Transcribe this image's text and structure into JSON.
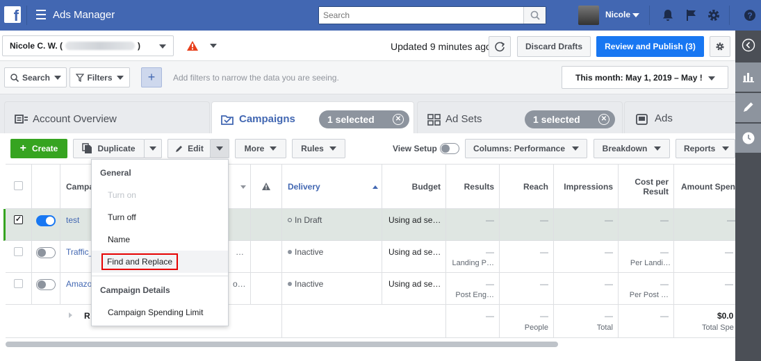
{
  "topbar": {
    "app_title": "Ads Manager",
    "search_placeholder": "Search",
    "user_name": "Nicole"
  },
  "account_bar": {
    "account_name": "Nicole C. W. (",
    "account_name_suffix": ")",
    "updated_text": "Updated 9 minutes ago",
    "discard_label": "Discard Drafts",
    "publish_label": "Review and Publish (3)"
  },
  "filter_bar": {
    "search_label": "Search",
    "filters_label": "Filters",
    "filter_hint": "Add filters to narrow the data you are seeing.",
    "date_range": "This month: May 1, 2019 – May !"
  },
  "tabs": [
    {
      "label": "Account Overview"
    },
    {
      "label": "Campaigns",
      "selected_text": "1 selected"
    },
    {
      "label": "Ad Sets",
      "selected_text": "1 selected"
    },
    {
      "label": "Ads"
    }
  ],
  "toolbar": {
    "create_label": "Create",
    "duplicate_label": "Duplicate",
    "edit_label": "Edit",
    "more_label": "More",
    "rules_label": "Rules",
    "view_setup_label": "View Setup",
    "columns_label": "Columns: Performance",
    "breakdown_label": "Breakdown",
    "reports_label": "Reports"
  },
  "table": {
    "headers": {
      "campaign": "Campa",
      "delivery": "Delivery",
      "budget": "Budget",
      "results": "Results",
      "reach": "Reach",
      "impressions": "Impressions",
      "cost_line1": "Cost per",
      "cost_line2": "Result",
      "amount": "Amount Spen"
    },
    "rows": [
      {
        "name": "test",
        "delivery": "In Draft",
        "budget": "Using ad se…",
        "results": "—",
        "results_sub": "",
        "reach": "—",
        "impressions": "—",
        "cost": "—",
        "cost_sub": "",
        "amount": "—",
        "toggle_on": true,
        "checked": true
      },
      {
        "name": "Traffic_",
        "trunc": "…",
        "delivery": "Inactive",
        "budget": "Using ad se…",
        "results": "—",
        "results_sub": "Landing P…",
        "reach": "—",
        "impressions": "—",
        "cost": "—",
        "cost_sub": "Per Landi…",
        "amount": "—",
        "toggle_on": false,
        "checked": false
      },
      {
        "name": "Amazo",
        "trunc": "o…",
        "delivery": "Inactive",
        "budget": "Using ad se…",
        "results": "—",
        "results_sub": "Post Eng…",
        "reach": "—",
        "impressions": "—",
        "cost": "—",
        "cost_sub": "Per Post …",
        "amount": "—",
        "toggle_on": false,
        "checked": false
      }
    ],
    "summary": {
      "label": "R",
      "results": "—",
      "reach": "—",
      "reach_sub": "People",
      "impressions": "—",
      "impressions_sub": "Total",
      "cost": "—",
      "amount": "$0.0",
      "amount_sub": "Total Spe"
    }
  },
  "edit_menu": {
    "general_header": "General",
    "items": [
      "Turn on",
      "Turn off",
      "Name",
      "Find and Replace"
    ],
    "details_header": "Campaign Details",
    "details_items": [
      "Campaign Spending Limit"
    ]
  },
  "colors": {
    "brand": "#4267b2",
    "create_green": "#36a420",
    "publish_blue": "#1877f2",
    "highlight_red": "#e60000",
    "selected_row": "#dfe6e2"
  }
}
